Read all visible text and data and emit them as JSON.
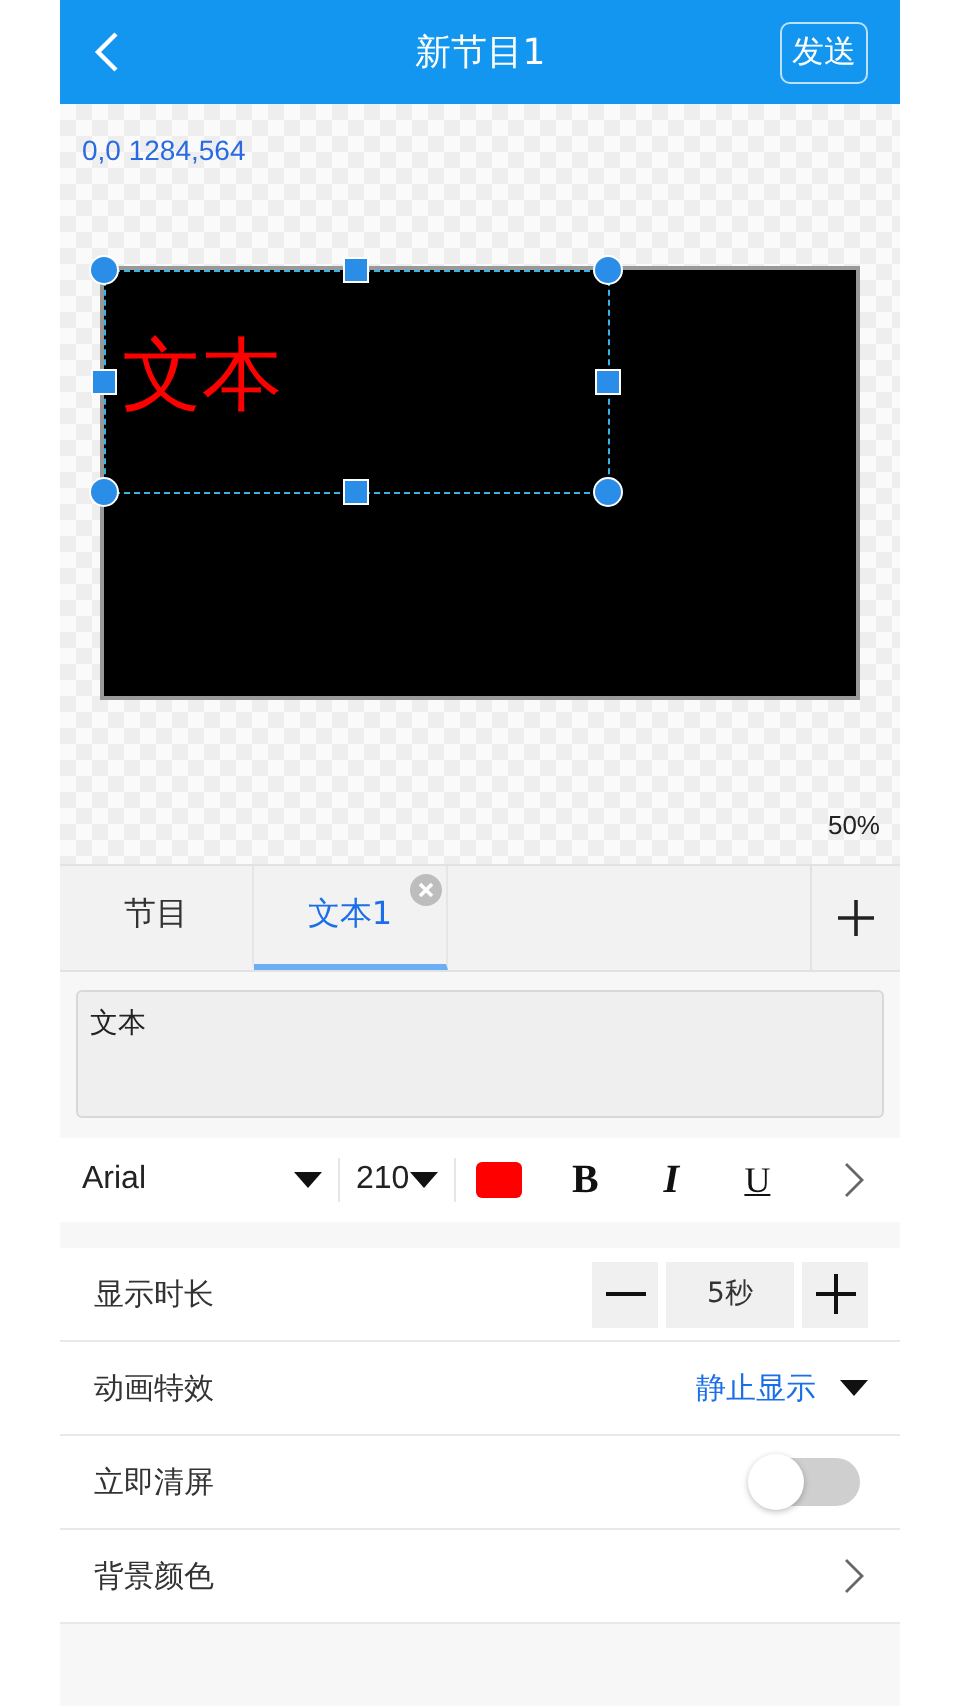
{
  "header": {
    "title": "新节目1",
    "send_button": "发送"
  },
  "canvas": {
    "coordinates": "0,0 1284,564",
    "text": "文本",
    "zoom": "50%"
  },
  "tabs": [
    {
      "label": "节目",
      "selected": false
    },
    {
      "label": "文本1",
      "selected": true
    }
  ],
  "text_input": {
    "value": "文本"
  },
  "toolbar": {
    "font": "Arial",
    "size": "210",
    "color": "#ff0000",
    "bold": "B",
    "italic": "I",
    "underline": "U"
  },
  "settings": [
    {
      "kind": "stepper",
      "label": "显示时长",
      "value": "5秒"
    },
    {
      "kind": "dropdown",
      "label": "动画特效",
      "value": "静止显示"
    },
    {
      "kind": "toggle",
      "label": "立即清屏",
      "on": false
    },
    {
      "kind": "link",
      "label": "背景颜色"
    }
  ]
}
